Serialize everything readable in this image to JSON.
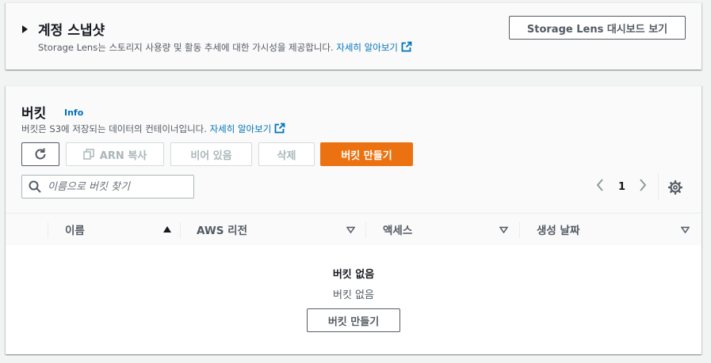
{
  "snapshot": {
    "title": "계정 스냅샷",
    "description": "Storage Lens는 스토리지 사용량 및 활동 추세에 대한 가시성을 제공합니다.",
    "learn_more": "자세히 알아보기",
    "dashboard_button": "Storage Lens 대시보드 보기"
  },
  "buckets": {
    "title": "버킷",
    "info": "Info",
    "description": "버킷은 S3에 저장되는 데이터의 컨테이너입니다.",
    "learn_more": "자세히 알아보기",
    "toolbar": {
      "refresh_icon": "refresh-icon",
      "copy_arn": "ARN 복사",
      "empty": "비어 있음",
      "delete": "삭제",
      "create": "버킷 만들기"
    },
    "search": {
      "placeholder": "이름으로 버킷 찾기"
    },
    "pagination": {
      "current_page": "1"
    },
    "columns": [
      {
        "label": "이름",
        "sort": "ascending"
      },
      {
        "label": "AWS 리전",
        "sort": "none"
      },
      {
        "label": "액세스",
        "sort": "none"
      },
      {
        "label": "생성 날짜",
        "sort": "none"
      }
    ],
    "empty_state": {
      "title": "버킷 없음",
      "subtitle": "버킷 없음",
      "create_button": "버킷 만들기"
    }
  },
  "colors": {
    "primary": "#ec7211",
    "link": "#0073bb",
    "text": "#16191f",
    "muted": "#545b64",
    "disabled": "#aab7b8"
  }
}
